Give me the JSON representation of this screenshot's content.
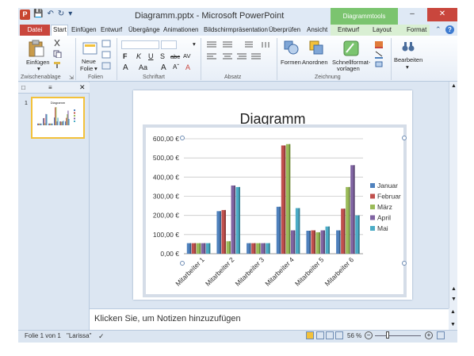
{
  "window": {
    "title": "Diagramm.pptx - Microsoft PowerPoint",
    "context_tab_title": "Diagrammtools"
  },
  "tabs": [
    "Datei",
    "Start",
    "Einfügen",
    "Entwurf",
    "Übergänge",
    "Animationen",
    "Bildschirmpräsentation",
    "Überprüfen",
    "Ansicht",
    "Entwurf",
    "Layout",
    "Format"
  ],
  "ribbon": {
    "paste": "Einfügen",
    "new_slide_1": "Neue",
    "new_slide_2": "Folie",
    "shapes": "Formen",
    "arrange": "Anordnen",
    "quick_styles_1": "Schnellformat-",
    "quick_styles_2": "vorlagen",
    "editing": "Bearbeiten",
    "font_letter_f": "F",
    "font_letter_k": "K",
    "font_letter_u": "U",
    "font_letter_s": "S",
    "font_letter_abc": "abc",
    "font_letter_av": "AV",
    "font_grow": "A",
    "font_shrink": "A",
    "font_aa": "Aa",
    "font_color": "A",
    "groups": {
      "clipboard": "Zwischenablage",
      "slides": "Folien",
      "font": "Schriftart",
      "paragraph": "Absatz",
      "drawing": "Zeichnung"
    }
  },
  "slide_panel": {
    "thumb_number": "1",
    "thumb_title": "Diagramm"
  },
  "notes": {
    "placeholder": "Klicken Sie, um Notizen hinzuzufügen"
  },
  "status": {
    "slide_info": "Folie 1 von 1",
    "theme": "\"Larissa\"",
    "zoom": "56 %",
    "zoom_minus": "−",
    "zoom_plus": "+"
  },
  "chart_data": {
    "type": "bar",
    "title": "Diagramm",
    "categories": [
      "Mitarbeiter 1",
      "Mitarbeiter 2",
      "Mitarbeiter 3",
      "Mitarbeiter 4",
      "Mitarbeiter 5",
      "Mitarbeiter 6"
    ],
    "series": [
      {
        "name": "Januar",
        "color": "#4f81bd",
        "values": [
          55,
          222,
          55,
          245,
          120,
          122
        ]
      },
      {
        "name": "Februar",
        "color": "#c0504d",
        "values": [
          55,
          228,
          55,
          565,
          122,
          235
        ]
      },
      {
        "name": "März",
        "color": "#9bbb59",
        "values": [
          55,
          65,
          55,
          572,
          112,
          348
        ]
      },
      {
        "name": "April",
        "color": "#8064a2",
        "values": [
          55,
          356,
          55,
          122,
          122,
          462
        ]
      },
      {
        "name": "Mai",
        "color": "#4bacc6",
        "values": [
          55,
          348,
          55,
          238,
          142,
          200
        ]
      }
    ],
    "yticks": [
      "0,00 €",
      "100,00 €",
      "200,00 €",
      "300,00 €",
      "400,00 €",
      "500,00 €",
      "600,00 €"
    ],
    "ylim": [
      0,
      600
    ],
    "legend_position": "right",
    "grid": true
  }
}
